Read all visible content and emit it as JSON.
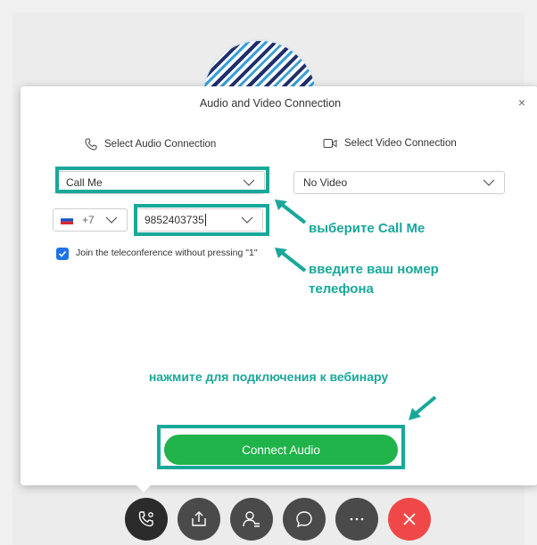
{
  "dialog": {
    "title": "Audio and Video Connection",
    "close_symbol": "×"
  },
  "audio": {
    "heading": "Select Audio Connection",
    "selected": "Call Me"
  },
  "video": {
    "heading": "Select Video Connection",
    "selected": "No Video"
  },
  "phone": {
    "country_code": "+7",
    "number": "9852403735"
  },
  "checkbox": {
    "label": "Join the teleconference without pressing \"1\"",
    "checked": true
  },
  "annotations": {
    "choose_call_me": "выберите Call Me",
    "enter_number": "введите ваш номер телефона",
    "press_connect": "нажмите для подключения к вебинару"
  },
  "connect_button": {
    "label": "Connect Audio"
  },
  "colors": {
    "accent_teal": "#19a89a",
    "connect_green": "#1fb34a",
    "end_red": "#f04848",
    "checkbox_blue": "#1e73e8"
  },
  "toolbar": {
    "icons": [
      "phone-settings-icon",
      "share-icon",
      "participants-icon",
      "chat-icon",
      "more-icon",
      "end-call-icon"
    ]
  }
}
